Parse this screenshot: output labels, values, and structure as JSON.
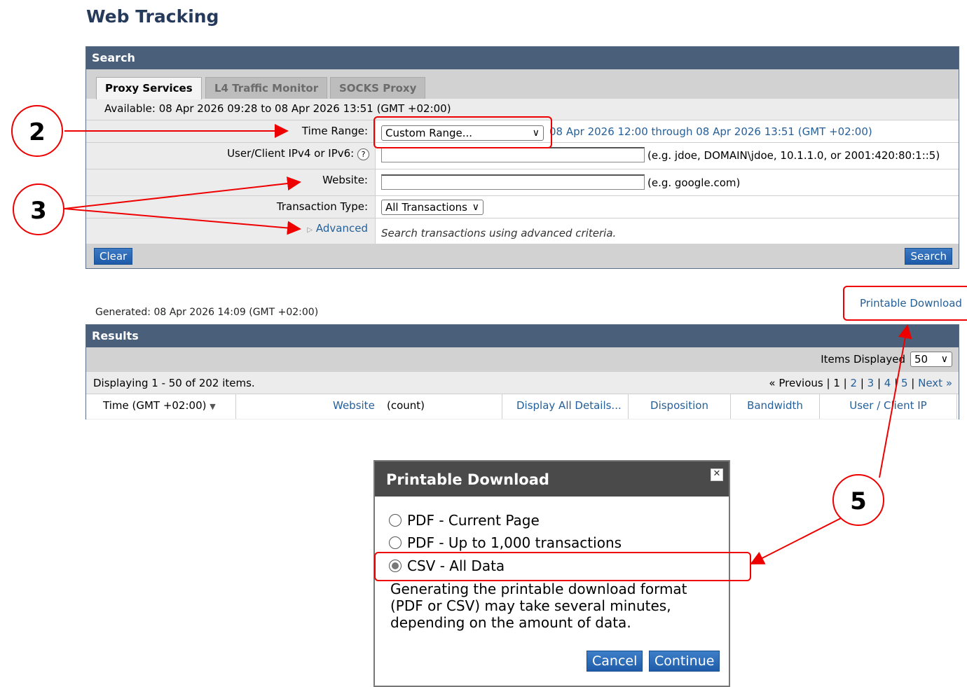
{
  "page": {
    "title": "Web Tracking"
  },
  "search": {
    "header": "Search",
    "tabs": [
      "Proxy Services",
      "L4 Traffic Monitor",
      "SOCKS Proxy"
    ],
    "available": "Available: 08 Apr 2026 09:28 to 08 Apr 2026 13:51 (GMT +02:00)",
    "time_range_label": "Time Range:",
    "time_range_value": "Custom Range...",
    "time_range_text": "08 Apr 2026 12:00 through 08 Apr 2026 13:51 (GMT +02:00)",
    "user_label": "User/Client IPv4 or IPv6:",
    "user_hint": "(e.g. jdoe, DOMAIN\\jdoe, 10.1.1.0, or 2001:420:80:1::5)",
    "website_label": "Website:",
    "website_hint": "(e.g. google.com)",
    "transaction_label": "Transaction Type:",
    "transaction_value": "All Transactions",
    "advanced_label": "Advanced",
    "advanced_hint": "Search transactions using advanced criteria.",
    "clear_button": "Clear",
    "search_button": "Search"
  },
  "results": {
    "generated": "Generated: 08 Apr 2026 14:09 (GMT +02:00)",
    "printable_download": "Printable Download",
    "header": "Results",
    "items_displayed_label": "Items Displayed",
    "items_displayed_value": "50",
    "displaying": "Displaying 1 - 50 of 202 items.",
    "pagination": {
      "previous": "« Previous",
      "current": "1",
      "pages": [
        "2",
        "3",
        "4",
        "5"
      ],
      "next": "Next »"
    },
    "columns": {
      "time": "Time (GMT +02:00)",
      "website": "Website",
      "count": "(count)",
      "details": "Display All Details...",
      "disposition": "Disposition",
      "bandwidth": "Bandwidth",
      "user": "User / Client IP"
    }
  },
  "dialog": {
    "title": "Printable Download",
    "options": [
      "PDF - Current Page",
      "PDF - Up to 1,000 transactions",
      "CSV - All Data"
    ],
    "selected_option": "CSV - All Data",
    "note": "Generating the printable download format (PDF or CSV) may take several minutes, depending on the amount of data.",
    "cancel_button": "Cancel",
    "continue_button": "Continue"
  },
  "annotations": {
    "step2": "2",
    "step3": "3",
    "step5": "5",
    "color": "#e00000"
  }
}
